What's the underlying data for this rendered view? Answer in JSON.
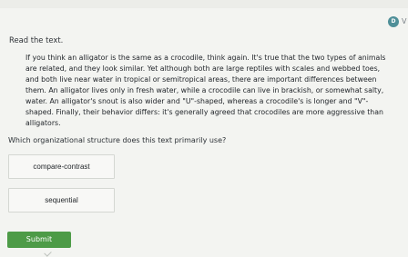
{
  "header": {
    "avatar_initial": "D",
    "avatar_label": "V"
  },
  "content": {
    "instruction": "Read the text.",
    "passage": "If you think an alligator is the same as a crocodile, think again. It's true that the two types of animals are related, and they look similar. Yet although both are large reptiles with scales and webbed toes, and both live near water in tropical or semitropical areas, there are important differences between them. An alligator lives only in fresh water, while a crocodile can live in brackish, or somewhat salty, water. An alligator's snout is also wider and \"U\"-shaped, whereas a crocodile's is longer and \"V\"-shaped. Finally, their behavior differs: it's generally agreed that crocodiles are more aggressive than alligators.",
    "question": "Which organizational structure does this text primarily use?",
    "choices": [
      "compare-contrast",
      "sequential"
    ],
    "submit_label": "Submit"
  },
  "colors": {
    "background": "#f3f4f1",
    "avatar": "#4f8f98",
    "submit": "#4d9b47",
    "choice_border": "#d4d7d2"
  }
}
